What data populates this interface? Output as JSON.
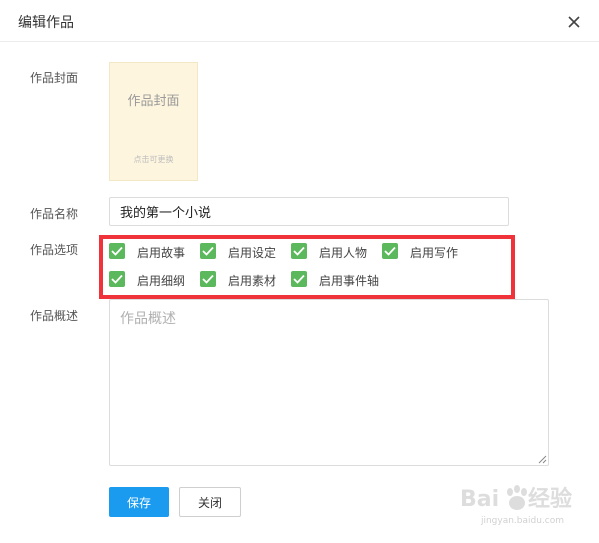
{
  "dialog": {
    "title": "编辑作品",
    "close_icon": "close-icon"
  },
  "cover": {
    "label": "作品封面",
    "title": "作品封面",
    "hint": "点击可更换",
    "background_color": "#fdf5de"
  },
  "name": {
    "label": "作品名称",
    "value": "我的第一个小说"
  },
  "options": {
    "label": "作品选项",
    "items": [
      {
        "label": "启用故事",
        "checked": true
      },
      {
        "label": "启用设定",
        "checked": true
      },
      {
        "label": "启用人物",
        "checked": true
      },
      {
        "label": "启用写作",
        "checked": true
      },
      {
        "label": "启用细纲",
        "checked": true
      },
      {
        "label": "启用素材",
        "checked": true
      },
      {
        "label": "启用事件轴",
        "checked": true
      }
    ],
    "checkbox_color": "#5cb85c",
    "highlight_color": "#f0323a"
  },
  "description": {
    "label": "作品概述",
    "placeholder": "作品概述",
    "value": ""
  },
  "actions": {
    "save_label": "保存",
    "close_label": "关闭",
    "save_color": "#1a9bf0"
  },
  "watermark": {
    "text": "jingyan.baidu.com"
  }
}
